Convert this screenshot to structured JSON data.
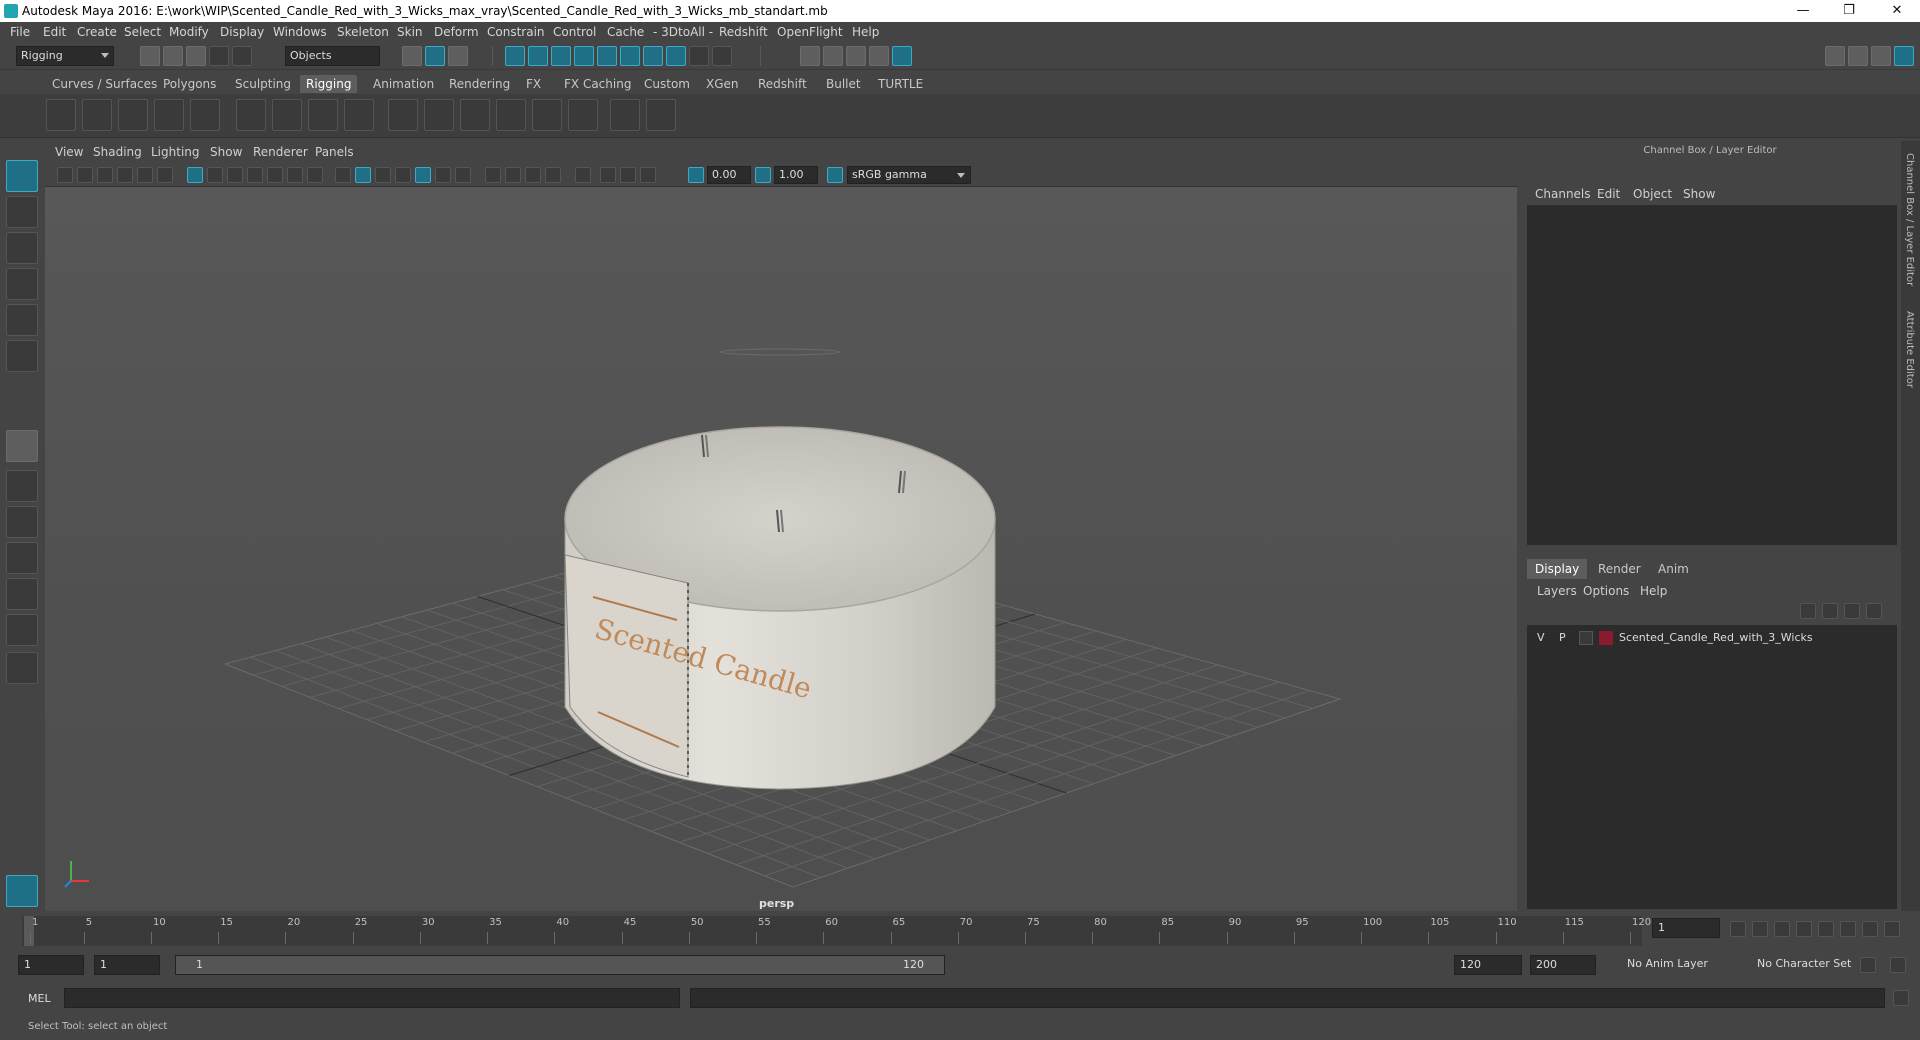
{
  "window": {
    "title": "Autodesk Maya 2016: E:\\work\\WIP\\Scented_Candle_Red_with_3_Wicks_max_vray\\Scented_Candle_Red_with_3_Wicks_mb_standart.mb",
    "minimize": "—",
    "restore": "❐",
    "close": "✕"
  },
  "menubar": [
    "File",
    "Edit",
    "Create",
    "Select",
    "Modify",
    "Display",
    "Windows",
    "Skeleton",
    "Skin",
    "Deform",
    "Constrain",
    "Control",
    "Cache",
    "- 3DtoAll -",
    "Redshift",
    "OpenFlight",
    "Help"
  ],
  "statusline": {
    "mode": "Rigging",
    "selection_mask": "Objects"
  },
  "shelf_tabs": [
    "Curves / Surfaces",
    "Polygons",
    "Sculpting",
    "Rigging",
    "Animation",
    "Rendering",
    "FX",
    "FX Caching",
    "Custom",
    "XGen",
    "Redshift",
    "Bullet",
    "TURTLE"
  ],
  "shelf_active": "Rigging",
  "viewport": {
    "menus": [
      "View",
      "Shading",
      "Lighting",
      "Show",
      "Renderer",
      "Panels"
    ],
    "exposure": "0.00",
    "gamma": "1.00",
    "color_space": "sRGB gamma",
    "camera_label": "persp",
    "candle_label": "Scented Candle"
  },
  "channel_box": {
    "title": "Channel Box / Layer Editor",
    "menus": [
      "Channels",
      "Edit",
      "Object",
      "Show"
    ]
  },
  "side_tabs": [
    "Channel Box / Layer Editor",
    "Attribute Editor"
  ],
  "layer_editor": {
    "tabs": [
      "Display",
      "Render",
      "Anim"
    ],
    "active_tab": "Display",
    "menus": [
      "Layers",
      "Options",
      "Help"
    ],
    "layers": [
      {
        "v": "V",
        "p": "P",
        "name": "Scented_Candle_Red_with_3_Wicks",
        "color": "#8b1a2e"
      }
    ]
  },
  "timeline": {
    "ticks": [
      "1",
      "5",
      "10",
      "15",
      "20",
      "25",
      "30",
      "35",
      "40",
      "45",
      "50",
      "55",
      "60",
      "65",
      "70",
      "75",
      "80",
      "85",
      "90",
      "95",
      "100",
      "105",
      "110",
      "115",
      "120"
    ],
    "current_frame": "1"
  },
  "range": {
    "start": "1",
    "playback_start": "1",
    "slider_start": "1",
    "slider_end": "120",
    "playback_end": "120",
    "end": "200",
    "anim_layer": "No Anim Layer",
    "character_set": "No Character Set"
  },
  "command_line": {
    "label": "MEL"
  },
  "help_line": "Select Tool: select an object"
}
